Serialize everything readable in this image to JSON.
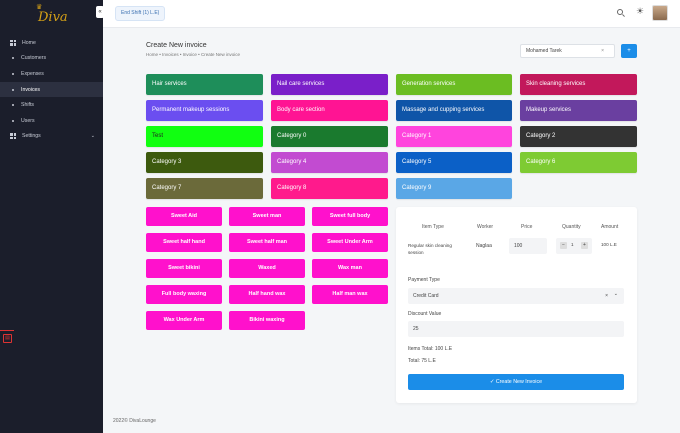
{
  "brand": {
    "logo_text": "Diva"
  },
  "sidebar": {
    "items": [
      {
        "label": "Home"
      },
      {
        "label": "Customers"
      },
      {
        "label": "Expenses"
      },
      {
        "label": "Invoices"
      },
      {
        "label": "Shifts"
      },
      {
        "label": "Users"
      },
      {
        "label": "Settings"
      }
    ],
    "active": "Invoices"
  },
  "topbar": {
    "end_shift_label": "End Shift (1) L.E)"
  },
  "page": {
    "title": "Create New invoice",
    "breadcrumb": "Home  •  Invoices  •  Invoice  •  Create New invoice"
  },
  "customer": {
    "value": "Mohamed Tarek",
    "clear": "×",
    "add_label": "+"
  },
  "services": [
    {
      "label": "Hair services",
      "color": "#1e8e5a"
    },
    {
      "label": "Nail care services",
      "color": "#7a1fc9"
    },
    {
      "label": "Generation services",
      "color": "#6bbd22"
    },
    {
      "label": "Skin cleaning services",
      "color": "#c2185b"
    },
    {
      "label": "Permanent makeup sessions",
      "color": "#6b4ef0"
    },
    {
      "label": "Body care section",
      "color": "#ff1493"
    },
    {
      "label": "Massage and cupping services",
      "color": "#0f55a8"
    },
    {
      "label": "Makeup services",
      "color": "#6a3fa0"
    },
    {
      "label": "Test",
      "color": "#11ff11",
      "dark": true
    },
    {
      "label": "Category 0",
      "color": "#1a7a2e"
    },
    {
      "label": "Category 1",
      "color": "#ff44dd"
    },
    {
      "label": "Category 2",
      "color": "#333333"
    },
    {
      "label": "Category 3",
      "color": "#3d5a0e"
    },
    {
      "label": "Category 4",
      "color": "#c24bd1"
    },
    {
      "label": "Category 5",
      "color": "#0b60c7"
    },
    {
      "label": "Category 6",
      "color": "#7ecb33"
    },
    {
      "label": "Category 7",
      "color": "#6b6a3a"
    },
    {
      "label": "Category 8",
      "color": "#ff1a8c"
    },
    {
      "label": "Category 9",
      "color": "#5aa7e6"
    }
  ],
  "items": [
    "Sweet Aid",
    "Sweet man",
    "Sweet full body",
    "Sweet half hand",
    "Sweet half man",
    "Sweet Under Arm",
    "Sweet bikini",
    "Waxed",
    "Wax man",
    "Full body waxing",
    "Half hand wax",
    "Half man wax",
    "Wax Under Arm",
    "Bikini waxing"
  ],
  "invoice": {
    "headers": {
      "item_type": "Item Type",
      "worker": "Worker",
      "price": "Price",
      "quantity": "Quantity",
      "amount": "Amount"
    },
    "row": {
      "item_type": "Regular skin cleaning session",
      "worker": "Naglaa",
      "price": "100",
      "minus": "−",
      "quantity": "1",
      "plus": "+",
      "amount": "100 L.E"
    },
    "payment_type_label": "Payment Type",
    "payment_type_value": "Credit Card",
    "payment_clear": "×",
    "payment_chevron": "⌄",
    "discount_label": "Discount Value",
    "discount_value": "25",
    "items_total": "Items Total: 100 L.E",
    "total": "Total: 75 L.E",
    "create_label": "✓  Create New Invoice"
  },
  "footer": {
    "text": "2022©  DivaLounge"
  }
}
